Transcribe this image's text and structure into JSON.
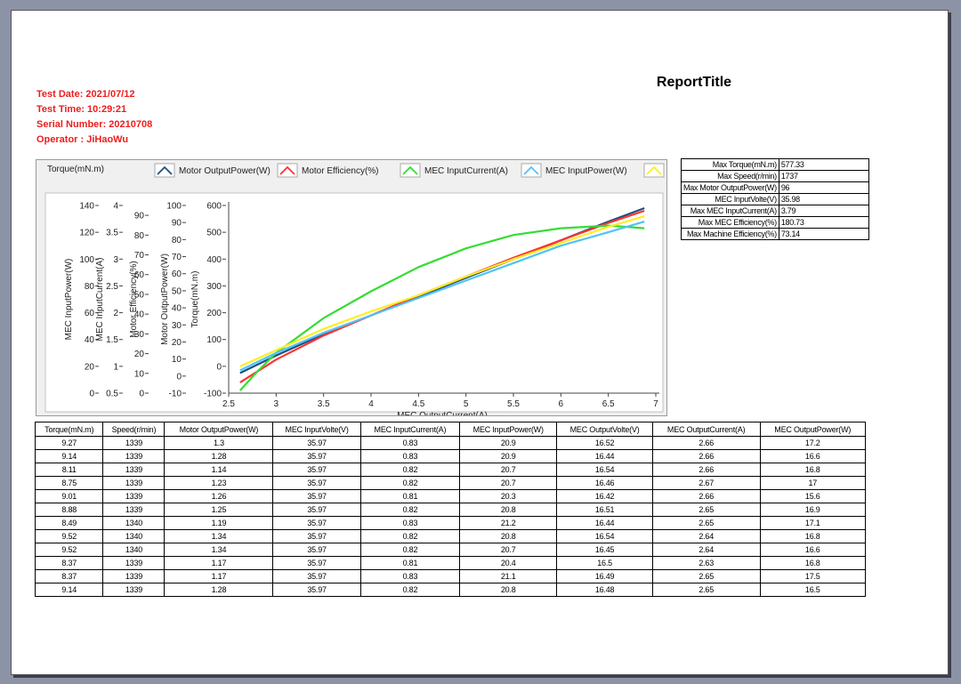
{
  "report": {
    "title": "ReportTitle"
  },
  "info": {
    "test_date": "Test Date: 2021/07/12",
    "test_time": "Test Time: 10:29:21",
    "serial": "Serial Number: 20210708",
    "operator": "Operator : JiHaoWu"
  },
  "chart_data": {
    "type": "line",
    "xlabel": "MEC OutputCurrent(A)",
    "xlim": [
      2.5,
      7
    ],
    "x_ticks": [
      "2.5",
      "3",
      "3.5",
      "4",
      "4.5",
      "5",
      "5.5",
      "6",
      "6.5",
      "7"
    ],
    "legend_label": "Torque(mN.m)",
    "series": [
      {
        "name": "Motor OutputPower(W)",
        "color": "#1e4f7c",
        "x": [
          2.62,
          3,
          3.5,
          4,
          4.5,
          5,
          5.5,
          6,
          6.5,
          6.88
        ],
        "y": [
          -25,
          40,
          120,
          190,
          260,
          330,
          400,
          470,
          540,
          590
        ]
      },
      {
        "name": "Motor Efficiency(%)",
        "color": "#ff3333",
        "x": [
          2.62,
          3,
          3.5,
          4,
          4.5,
          5,
          5.5,
          6,
          6.5,
          6.88
        ],
        "y": [
          -60,
          25,
          115,
          190,
          265,
          335,
          405,
          470,
          535,
          580
        ]
      },
      {
        "name": "MEC InputCurrent(A)",
        "color": "#33dd33",
        "x": [
          2.62,
          2.8,
          3,
          3.5,
          4,
          4.5,
          5,
          5.5,
          6,
          6.5,
          6.7,
          6.88
        ],
        "y": [
          -90,
          -20,
          50,
          180,
          280,
          370,
          440,
          490,
          515,
          525,
          520,
          515
        ]
      },
      {
        "name": "MEC InputPower(W)",
        "color": "#4fc3f7",
        "x": [
          2.62,
          3,
          3.5,
          4,
          4.5,
          5,
          5.5,
          6,
          6.5,
          6.88
        ],
        "y": [
          -15,
          50,
          125,
          190,
          255,
          320,
          385,
          450,
          500,
          540
        ]
      },
      {
        "name": "",
        "color": "#ffee22",
        "x": [
          2.62,
          3,
          3.5,
          4,
          4.5,
          5,
          5.5,
          6,
          6.5,
          6.88
        ],
        "y": [
          0,
          60,
          140,
          205,
          265,
          335,
          400,
          460,
          520,
          560
        ]
      }
    ],
    "axes": [
      {
        "label": "MEC InputPower(W)",
        "ticks": [
          "0",
          "20",
          "40",
          "60",
          "80",
          "100",
          "120",
          "140"
        ],
        "lim": [
          0,
          140
        ]
      },
      {
        "label": "MEC InputCurrent(A)",
        "ticks": [
          "0.5",
          "1",
          "1.5",
          "2",
          "2.5",
          "3",
          "3.5",
          "4"
        ],
        "lim": [
          0.5,
          4
        ]
      },
      {
        "label": "Motor Efficiency(%)",
        "ticks": [
          "0",
          "10",
          "20",
          "30",
          "40",
          "50",
          "60",
          "70",
          "80",
          "90"
        ],
        "lim": [
          0,
          95
        ]
      },
      {
        "label": "Motor OutputPower(W)",
        "ticks": [
          "-10",
          "0",
          "10",
          "20",
          "30",
          "40",
          "50",
          "60",
          "70",
          "80",
          "90",
          "100"
        ],
        "lim": [
          -10,
          100
        ]
      },
      {
        "label": "Torque(mN.m)",
        "ticks": [
          "-100",
          "0",
          "100",
          "200",
          "300",
          "400",
          "500",
          "600"
        ],
        "lim": [
          -100,
          600
        ]
      }
    ]
  },
  "summary": [
    {
      "k": "Max Torque(mN.m)",
      "v": "577.33"
    },
    {
      "k": "Max Speed(r/min)",
      "v": "1737"
    },
    {
      "k": "Max Motor OutputPower(W)",
      "v": "96"
    },
    {
      "k": "MEC InputVolte(V)",
      "v": "35.98"
    },
    {
      "k": "Max MEC InputCurrent(A)",
      "v": "3.79"
    },
    {
      "k": "Max MEC Efficiency(%)",
      "v": "180.73"
    },
    {
      "k": "Max Machine Efficiency(%)",
      "v": "73.14"
    }
  ],
  "table": {
    "headers": [
      "Torque(mN.m)",
      "Speed(r/min)",
      "Motor OutputPower(W)",
      "MEC InputVolte(V)",
      "MEC InputCurrent(A)",
      "MEC InputPower(W)",
      "MEC OutputVolte(V)",
      "MEC OutputCurrent(A)",
      "MEC OutputPower(W)"
    ],
    "rows": [
      [
        "9.27",
        "1339",
        "1.3",
        "35.97",
        "0.83",
        "20.9",
        "16.52",
        "2.66",
        "17.2"
      ],
      [
        "9.14",
        "1339",
        "1.28",
        "35.97",
        "0.83",
        "20.9",
        "16.44",
        "2.66",
        "16.6"
      ],
      [
        "8.11",
        "1339",
        "1.14",
        "35.97",
        "0.82",
        "20.7",
        "16.54",
        "2.66",
        "16.8"
      ],
      [
        "8.75",
        "1339",
        "1.23",
        "35.97",
        "0.82",
        "20.7",
        "16.46",
        "2.67",
        "17"
      ],
      [
        "9.01",
        "1339",
        "1.26",
        "35.97",
        "0.81",
        "20.3",
        "16.42",
        "2.66",
        "15.6"
      ],
      [
        "8.88",
        "1339",
        "1.25",
        "35.97",
        "0.82",
        "20.8",
        "16.51",
        "2.65",
        "16.9"
      ],
      [
        "8.49",
        "1340",
        "1.19",
        "35.97",
        "0.83",
        "21.2",
        "16.44",
        "2.65",
        "17.1"
      ],
      [
        "9.52",
        "1340",
        "1.34",
        "35.97",
        "0.82",
        "20.8",
        "16.54",
        "2.64",
        "16.8"
      ],
      [
        "9.52",
        "1340",
        "1.34",
        "35.97",
        "0.82",
        "20.7",
        "16.45",
        "2.64",
        "16.6"
      ],
      [
        "8.37",
        "1339",
        "1.17",
        "35.97",
        "0.81",
        "20.4",
        "16.5",
        "2.63",
        "16.8"
      ],
      [
        "8.37",
        "1339",
        "1.17",
        "35.97",
        "0.83",
        "21.1",
        "16.49",
        "2.65",
        "17.5"
      ],
      [
        "9.14",
        "1339",
        "1.28",
        "35.97",
        "0.82",
        "20.8",
        "16.48",
        "2.65",
        "16.5"
      ]
    ]
  }
}
